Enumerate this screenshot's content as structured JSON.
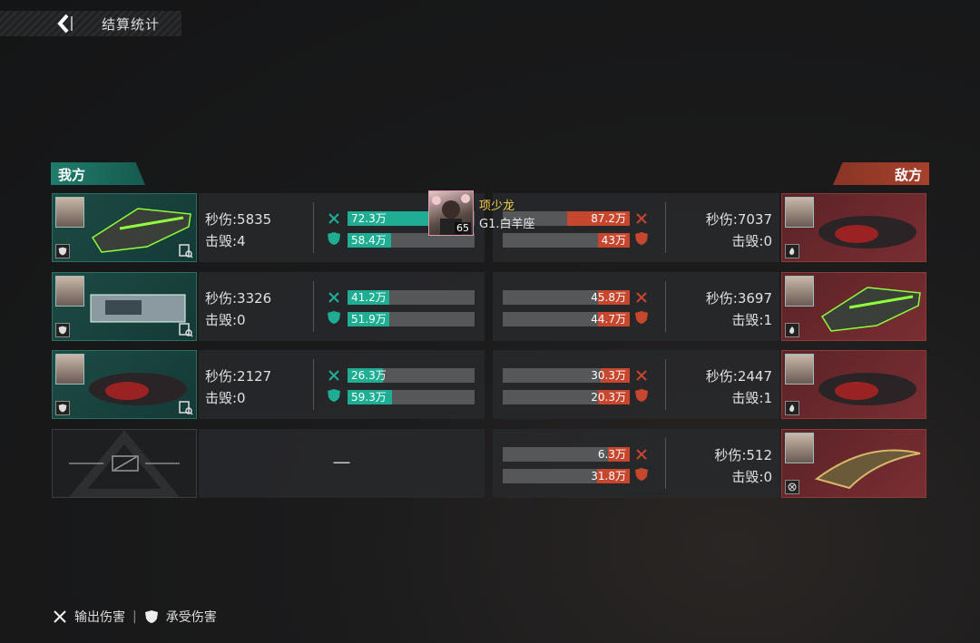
{
  "header": {
    "title": "结算统计"
  },
  "sides": {
    "ally": "我方",
    "enemy": "敌方"
  },
  "player_card": {
    "name": "项少龙",
    "group": "G1.白羊座",
    "level": "65"
  },
  "ally_rows": [
    {
      "dps": "秒伤:5835",
      "kills": "击毁:4",
      "dmg_out": "72.3万",
      "dmg_out_pct": 0.64,
      "dmg_in": "58.4万",
      "dmg_in_pct": 0.34
    },
    {
      "dps": "秒伤:3326",
      "kills": "击毁:0",
      "dmg_out": "41.2万",
      "dmg_out_pct": 0.33,
      "dmg_in": "51.9万",
      "dmg_in_pct": 0.33
    },
    {
      "dps": "秒伤:2127",
      "kills": "击毁:0",
      "dmg_out": "26.3万",
      "dmg_out_pct": 0.28,
      "dmg_in": "59.3万",
      "dmg_in_pct": 0.35
    }
  ],
  "ally_empty": {
    "dash": "—"
  },
  "enemy_rows": [
    {
      "dps": "秒伤:7037",
      "kills": "击毁:0",
      "dmg_out": "87.2万",
      "dmg_out_pct": 0.49,
      "dmg_in": "43万",
      "dmg_in_pct": 0.25
    },
    {
      "dps": "秒伤:3697",
      "kills": "击毁:1",
      "dmg_out": "45.8万",
      "dmg_out_pct": 0.25,
      "dmg_in": "44.7万",
      "dmg_in_pct": 0.25
    },
    {
      "dps": "秒伤:2447",
      "kills": "击毁:1",
      "dmg_out": "30.3万",
      "dmg_out_pct": 0.23,
      "dmg_in": "20.3万",
      "dmg_in_pct": 0.25
    },
    {
      "dps": "秒伤:512",
      "kills": "击毁:0",
      "dmg_out": "6.3万",
      "dmg_out_pct": 0.17,
      "dmg_in": "31.8万",
      "dmg_in_pct": 0.26
    }
  ],
  "legend": {
    "output": "输出伤害",
    "taken": "承受伤害",
    "separator": "|"
  },
  "colors": {
    "ally": "#1fae94",
    "enemy": "#c7462e"
  }
}
